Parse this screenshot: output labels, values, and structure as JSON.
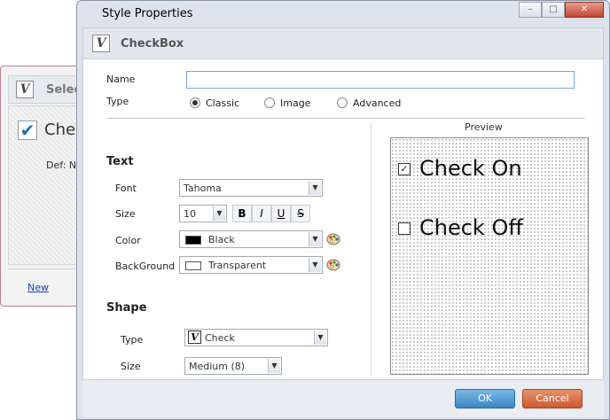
{
  "background_window": {
    "title": "Selec",
    "item_label": "Chec",
    "def_label": "Def: N",
    "new_link": "New"
  },
  "dialog": {
    "title": "Style Properties",
    "header": "CheckBox",
    "window_buttons": {
      "minimize": "–",
      "maximize": "□",
      "close": "✕"
    }
  },
  "form": {
    "name_label": "Name",
    "name_value": "",
    "type_label": "Type",
    "type_options": [
      "Classic",
      "Image",
      "Advanced"
    ],
    "type_selected": "Classic"
  },
  "text_section": {
    "title": "Text",
    "font_label": "Font",
    "font_value": "Tahoma",
    "size_label": "Size",
    "size_value": "10",
    "format_buttons": [
      "B",
      "I",
      "U",
      "S"
    ],
    "color_label": "Color",
    "color_value": "Black",
    "color_swatch": "#000000",
    "background_label": "BackGround",
    "background_value": "Transparent",
    "background_swatch": "#ffffff"
  },
  "shape_section": {
    "title": "Shape",
    "type_label": "Type",
    "type_value": "Check",
    "size_label": "Size",
    "size_value": "Medium (8)"
  },
  "preview": {
    "title": "Preview",
    "check_on": "Check On",
    "check_off": "Check Off"
  },
  "footer": {
    "ok": "OK",
    "cancel": "Cancel"
  },
  "colors": {
    "ok_button": "#3b86c4",
    "cancel_button": "#c95a30",
    "accent_border": "#6fa7d7"
  }
}
